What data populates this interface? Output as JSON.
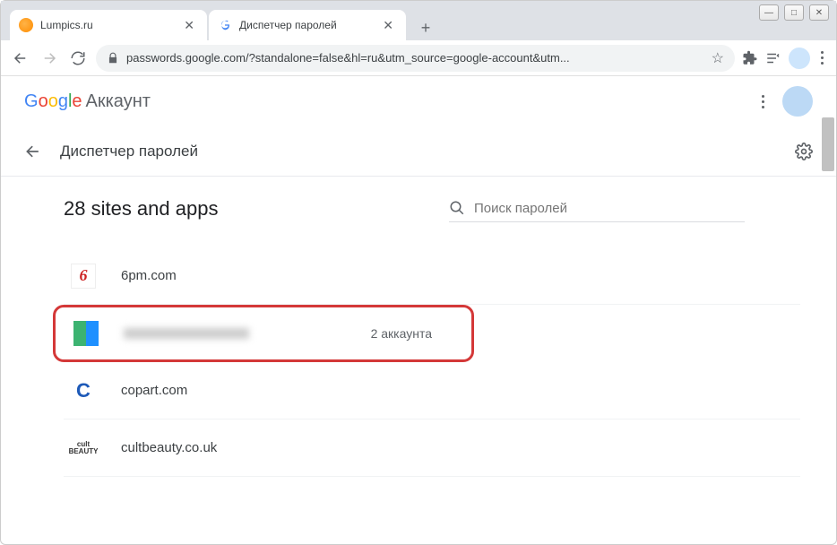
{
  "window": {
    "tabs": [
      {
        "title": "Lumpics.ru",
        "favicon": "orange"
      },
      {
        "title": "Диспетчер паролей",
        "favicon": "google"
      }
    ],
    "url": "passwords.google.com/?standalone=false&hl=ru&utm_source=google-account&utm..."
  },
  "header": {
    "logo": "Google",
    "account_label": "Аккаунт"
  },
  "subheader": {
    "title": "Диспетчер паролей"
  },
  "content": {
    "count_text": "28 sites and apps",
    "search_placeholder": "Поиск паролей",
    "sites": [
      {
        "name": "6pm.com",
        "icon": "6pm"
      },
      {
        "name": "",
        "blurred": true,
        "icon": "multi",
        "accounts_text": "2 аккаунта",
        "highlighted": true
      },
      {
        "name": "copart.com",
        "icon": "copart"
      },
      {
        "name": "cultbeauty.co.uk",
        "icon": "beauty"
      }
    ]
  }
}
